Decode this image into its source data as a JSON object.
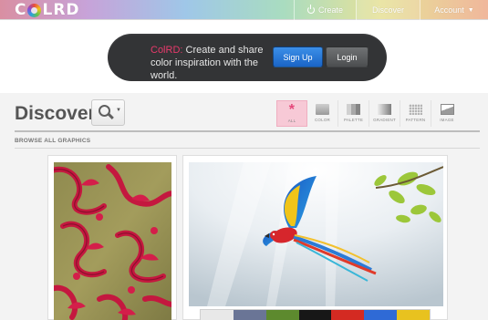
{
  "topbar": {
    "logo_left": "C",
    "logo_right": "LRD",
    "nav": {
      "create": "Create",
      "discover": "Discover",
      "account": "Account"
    },
    "gradient_colors": [
      "#d98fa2",
      "#c7a3d9",
      "#9fc7e8",
      "#a9dcc0",
      "#e7e29a",
      "#f0b79b"
    ]
  },
  "promo": {
    "brand": "ColRD:",
    "text": " Create and share color inspiration with the world.",
    "signup_label": "Sign Up",
    "login_label": "Login"
  },
  "discover": {
    "title": "Discover",
    "filters": [
      {
        "label": "ALL",
        "icon": "asterisk-icon",
        "active": true
      },
      {
        "label": "COLOR",
        "icon": "color-icon",
        "active": false
      },
      {
        "label": "PALETTE",
        "icon": "palette-icon",
        "active": false
      },
      {
        "label": "GRADIENT",
        "icon": "gradient-icon",
        "active": false
      },
      {
        "label": "PATTERN",
        "icon": "pattern-icon",
        "active": false
      },
      {
        "label": "IMAGE",
        "icon": "image-icon",
        "active": false
      }
    ],
    "browse_label": "BROWSE ALL GRAPHICS"
  },
  "cards": {
    "left_image": "red-damask-pattern-image",
    "right_image": "flying-macaw-parrot-image",
    "palette_colors": [
      "#e8e8e8",
      "#6a7596",
      "#5d8a2e",
      "#171717",
      "#d42a22",
      "#2f6ad6",
      "#e8c21f"
    ]
  },
  "colors": {
    "brand_pink": "#e8396b",
    "signup_blue": "#1a64c6",
    "pill_dark": "#333436"
  }
}
